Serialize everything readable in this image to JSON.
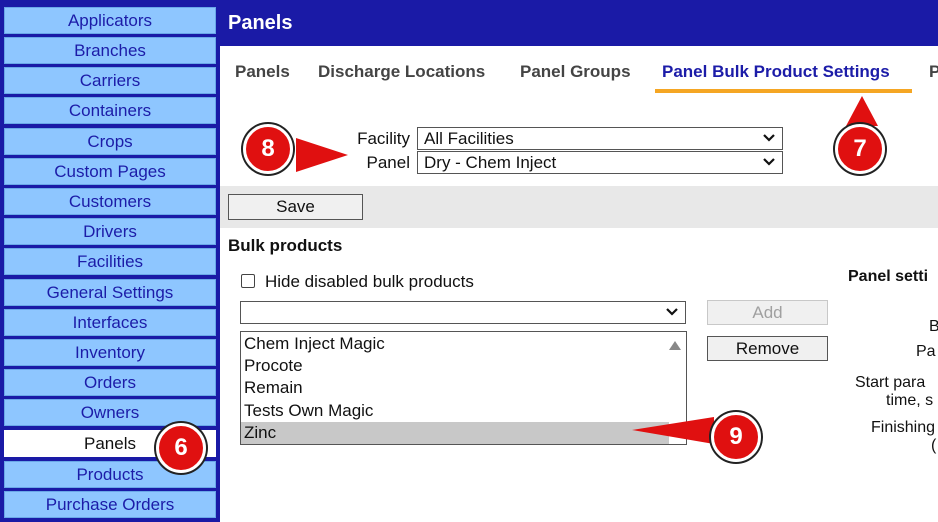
{
  "sidebar": {
    "items": [
      {
        "label": "Applicators"
      },
      {
        "label": "Branches"
      },
      {
        "label": "Carriers"
      },
      {
        "label": "Containers"
      },
      {
        "label": "Crops"
      },
      {
        "label": "Custom Pages"
      },
      {
        "label": "Customers"
      },
      {
        "label": "Drivers"
      },
      {
        "label": "Facilities"
      },
      {
        "label": "General Settings"
      },
      {
        "label": "Interfaces"
      },
      {
        "label": "Inventory"
      },
      {
        "label": "Orders"
      },
      {
        "label": "Owners"
      },
      {
        "label": "Panels",
        "active": true
      },
      {
        "label": "Products"
      },
      {
        "label": "Purchase Orders"
      }
    ]
  },
  "header": {
    "title": "Panels"
  },
  "tabs": [
    {
      "label": "Panels"
    },
    {
      "label": "Discharge Locations"
    },
    {
      "label": "Panel Groups"
    },
    {
      "label": "Panel Bulk Product Settings",
      "active": true
    },
    {
      "label": "P"
    }
  ],
  "filters": {
    "facility": {
      "label": "Facility",
      "value": "All Facilities"
    },
    "panel": {
      "label": "Panel",
      "value": "Dry - Chem Inject"
    }
  },
  "toolbar": {
    "save_label": "Save"
  },
  "bulk": {
    "heading": "Bulk products",
    "hide_disabled_label": "Hide disabled bulk products",
    "product_select_value": "",
    "add_label": "Add",
    "remove_label": "Remove",
    "items": [
      "Chem Inject Magic",
      "Procote",
      "Remain",
      "Tests Own Magic",
      "Zinc"
    ],
    "selected_index": 4
  },
  "right_panel": {
    "heading": "Panel setti",
    "line_b": "B",
    "line_pa": "Pa",
    "line_start1": "Start para",
    "line_start2": "time, s",
    "line_finish": "Finishing",
    "line_paren": "("
  },
  "callouts": {
    "c6": "6",
    "c7": "7",
    "c8": "8",
    "c9": "9"
  },
  "colors": {
    "brand_blue": "#1a1aa6",
    "sidebar_item": "#8ec6ff",
    "tab_underline": "#f5a623",
    "callout_red": "#e01010"
  }
}
